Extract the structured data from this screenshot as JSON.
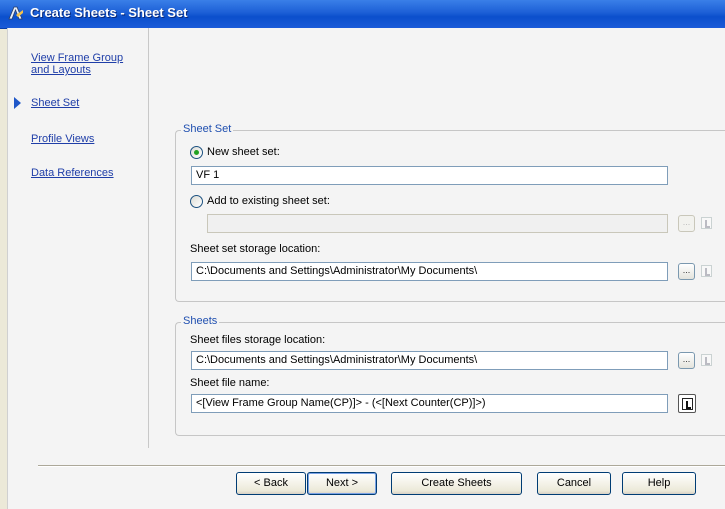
{
  "window": {
    "title": "Create Sheets - Sheet Set",
    "app_icon": "civil3d-app-icon"
  },
  "nav": {
    "items": [
      {
        "label": "View Frame Group and Layouts",
        "line1": "View Frame Group",
        "line2": "and Layouts",
        "active": false
      },
      {
        "label": "Sheet Set",
        "active": true
      },
      {
        "label": "Profile Views",
        "active": false
      },
      {
        "label": "Data References",
        "active": false
      }
    ],
    "active_marker_icon": "triangle-right-icon"
  },
  "sheet_set": {
    "legend": "Sheet Set",
    "new_sheet_set": {
      "label": "New sheet set:",
      "selected": true,
      "value": "VF 1"
    },
    "add_existing": {
      "label": "Add to existing sheet set:",
      "selected": false,
      "value": ""
    },
    "storage": {
      "label": "Sheet set storage location:",
      "value": "C:\\Documents and Settings\\Administrator\\My Documents\\"
    },
    "browse_label": "..."
  },
  "sheets": {
    "legend": "Sheets",
    "files_storage": {
      "label": "Sheet files storage location:",
      "value": "C:\\Documents and Settings\\Administrator\\My Documents\\"
    },
    "file_name": {
      "label": "Sheet file name:",
      "value": "<[View Frame Group Name(CP)]> - (<[Next Counter(CP)]>)"
    },
    "browse_label": "..."
  },
  "buttons": {
    "back": "< Back",
    "next": "Next >",
    "create": "Create Sheets",
    "cancel": "Cancel",
    "help": "Help"
  }
}
